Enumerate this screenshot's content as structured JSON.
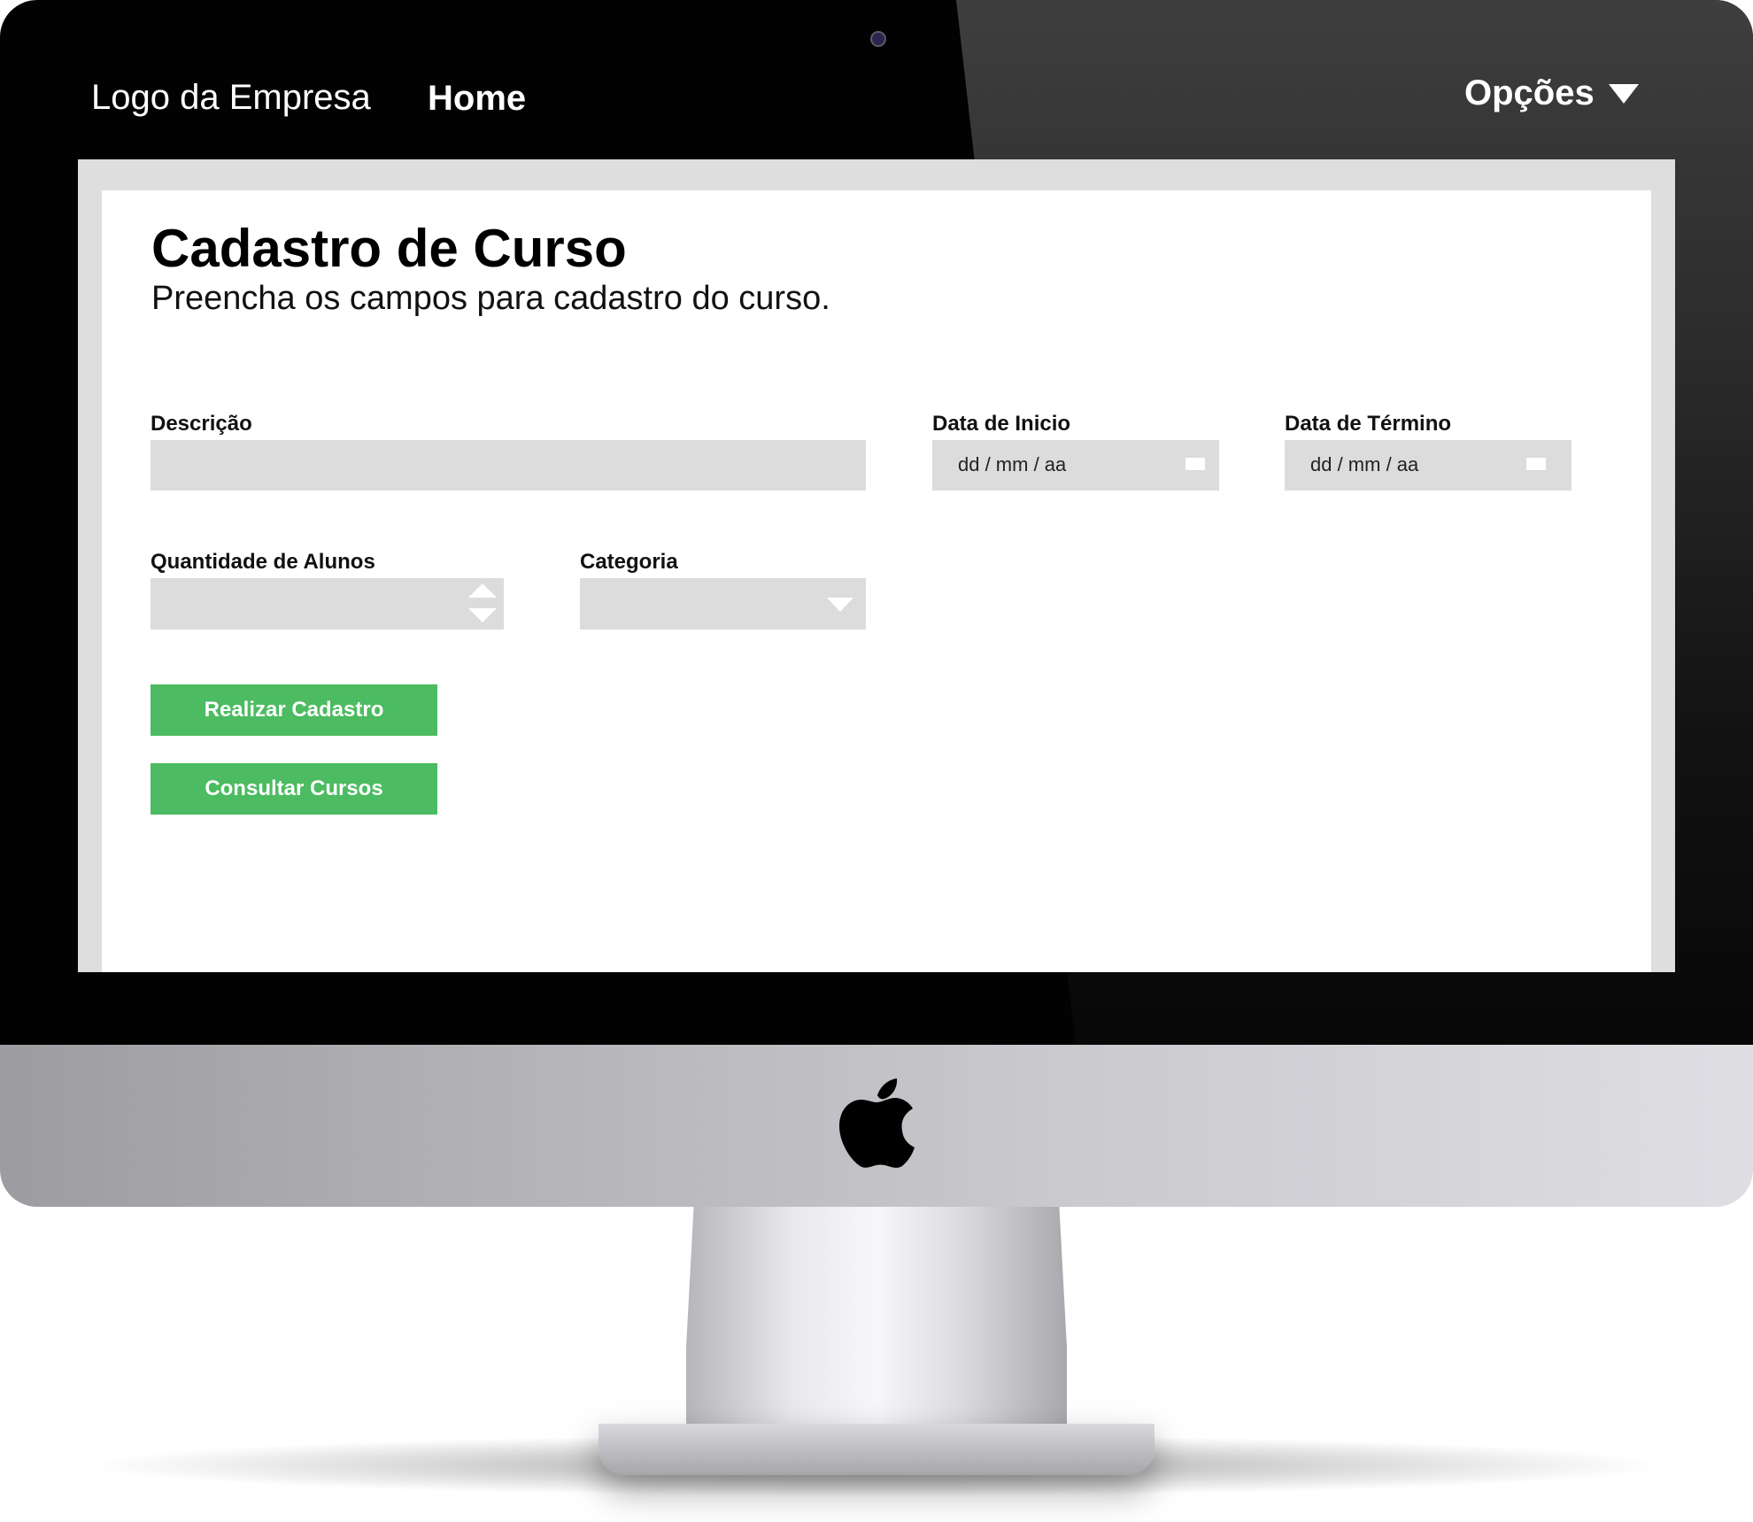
{
  "nav": {
    "logo": "Logo da Empresa",
    "home": "Home",
    "options": "Opções"
  },
  "form": {
    "title": "Cadastro de Curso",
    "subtitle": "Preencha os campos para cadastro do curso.",
    "descricao_label": "Descrição",
    "descricao_value": "",
    "data_inicio_label": "Data de Inicio",
    "data_inicio_placeholder": "dd / mm / aa",
    "data_termino_label": "Data de Término",
    "data_termino_placeholder": "dd / mm / aa",
    "quantidade_label": "Quantidade de Alunos",
    "quantidade_value": "",
    "categoria_label": "Categoria",
    "categoria_value": ""
  },
  "buttons": {
    "realizar": "Realizar Cadastro",
    "consultar": "Consultar Cursos"
  },
  "colors": {
    "accent_green": "#4cbb61",
    "field_gray": "#dcdcdc"
  }
}
